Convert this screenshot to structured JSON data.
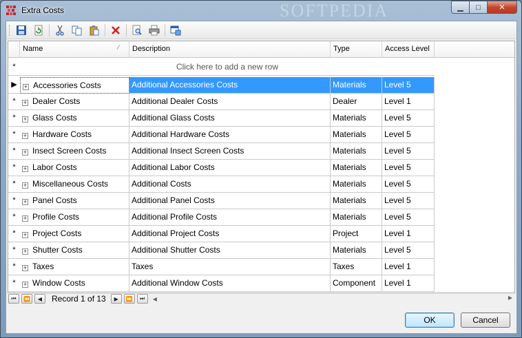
{
  "window": {
    "title": "Extra Costs",
    "watermark": "SOFTPEDIA",
    "close_glyph": "✕",
    "min_glyph": "▁",
    "max_glyph": "□"
  },
  "toolbar": {
    "icons": [
      "save-icon",
      "refresh-icon",
      "cut-icon",
      "copy-icon",
      "paste-icon",
      "delete-icon",
      "print-preview-icon",
      "print-icon",
      "export-icon"
    ]
  },
  "grid": {
    "columns": [
      "Name",
      "Description",
      "Type",
      "Access Level"
    ],
    "new_row_text": "Click here to add a new row",
    "new_row_marker": "*",
    "selected_marker": "▶",
    "rows": [
      {
        "marker": "▶",
        "name": "Accessories Costs",
        "description": "Additional Accessories Costs",
        "type": "Materials",
        "access": "Level 5"
      },
      {
        "marker": "*",
        "name": "Dealer Costs",
        "description": "Additional Dealer Costs",
        "type": "Dealer",
        "access": "Level 1"
      },
      {
        "marker": "*",
        "name": "Glass Costs",
        "description": "Additional Glass Costs",
        "type": "Materials",
        "access": "Level 5"
      },
      {
        "marker": "*",
        "name": "Hardware Costs",
        "description": "Additional Hardware Costs",
        "type": "Materials",
        "access": "Level 5"
      },
      {
        "marker": "*",
        "name": "Insect Screen Costs",
        "description": "Additional Insect Screen Costs",
        "type": "Materials",
        "access": "Level 5"
      },
      {
        "marker": "*",
        "name": "Labor Costs",
        "description": "Additional Labor Costs",
        "type": "Materials",
        "access": "Level 5"
      },
      {
        "marker": "*",
        "name": "Miscellaneous Costs",
        "description": "Additional Costs",
        "type": "Materials",
        "access": "Level 5"
      },
      {
        "marker": "*",
        "name": "Panel Costs",
        "description": "Additional Panel Costs",
        "type": "Materials",
        "access": "Level 5"
      },
      {
        "marker": "*",
        "name": "Profile Costs",
        "description": "Additional Profile Costs",
        "type": "Materials",
        "access": "Level 5"
      },
      {
        "marker": "*",
        "name": "Project Costs",
        "description": "Additional Project Costs",
        "type": "Project",
        "access": "Level 1"
      },
      {
        "marker": "*",
        "name": "Shutter Costs",
        "description": "Additional Shutter Costs",
        "type": "Materials",
        "access": "Level 5"
      },
      {
        "marker": "*",
        "name": "Taxes",
        "description": "Taxes",
        "type": "Taxes",
        "access": "Level 1"
      },
      {
        "marker": "*",
        "name": "Window Costs",
        "description": "Additional Window Costs",
        "type": "Component",
        "access": "Level 1"
      }
    ],
    "selected_index": 0,
    "selection_color": "#3399ff"
  },
  "navigator": {
    "record_text": "Record 1 of 13",
    "first": "⏮",
    "prev_page": "⏪",
    "prev": "◀",
    "next": "▶",
    "next_page": "⏩",
    "last": "⏭"
  },
  "footer": {
    "ok_label": "OK",
    "cancel_label": "Cancel"
  }
}
